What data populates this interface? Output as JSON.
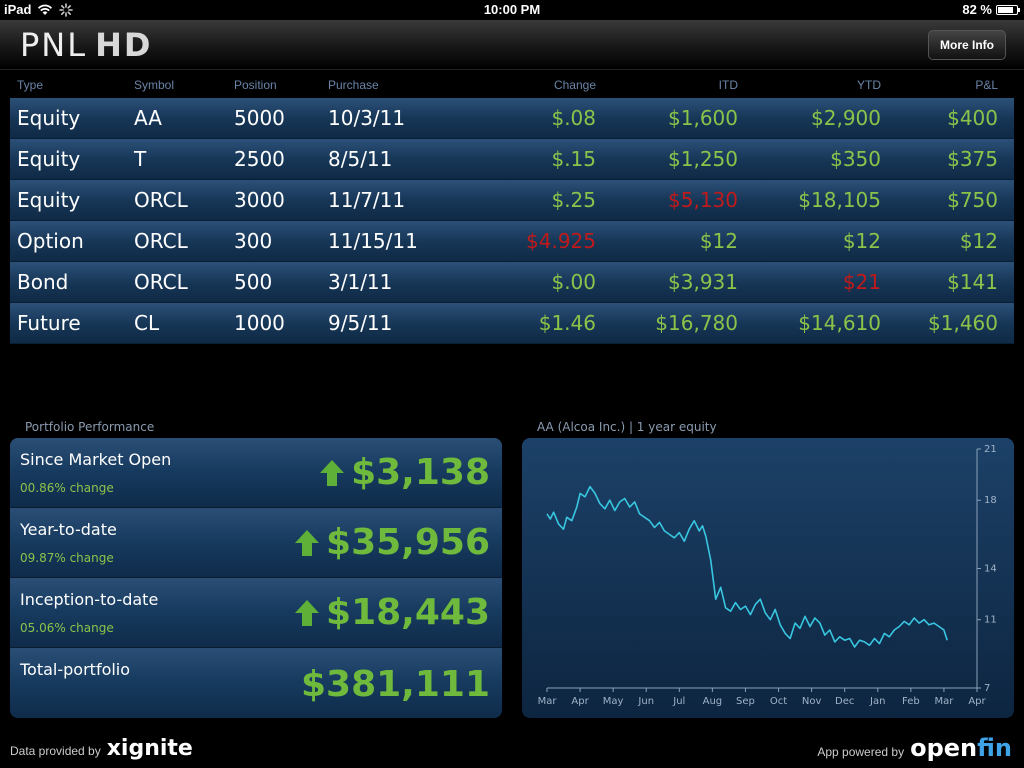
{
  "status_bar": {
    "device": "iPad",
    "time": "10:00 PM",
    "battery": "82 %",
    "battery_level": 0.82
  },
  "header": {
    "logo_pnl": "PNL",
    "logo_hd": "HD",
    "more_info_label": "More Info"
  },
  "table": {
    "columns": [
      "Type",
      "Symbol",
      "Position",
      "Purchase",
      "Change",
      "ITD",
      "YTD",
      "P&L"
    ],
    "rows": [
      {
        "type": "Equity",
        "symbol": "AA",
        "position": "5000",
        "purchase": "10/3/11",
        "change": "$.08",
        "change_status": "pos",
        "itd": "$1,600",
        "itd_status": "pos",
        "ytd": "$2,900",
        "ytd_status": "pos",
        "pnl": "$400",
        "pnl_status": "pos"
      },
      {
        "type": "Equity",
        "symbol": "T",
        "position": "2500",
        "purchase": "8/5/11",
        "change": "$.15",
        "change_status": "pos",
        "itd": "$1,250",
        "itd_status": "pos",
        "ytd": "$350",
        "ytd_status": "pos",
        "pnl": "$375",
        "pnl_status": "pos"
      },
      {
        "type": "Equity",
        "symbol": "ORCL",
        "position": "3000",
        "purchase": "11/7/11",
        "change": "$.25",
        "change_status": "pos",
        "itd": "$5,130",
        "itd_status": "neg",
        "ytd": "$18,105",
        "ytd_status": "pos",
        "pnl": "$750",
        "pnl_status": "pos"
      },
      {
        "type": "Option",
        "symbol": "ORCL",
        "position": "300",
        "purchase": "11/15/11",
        "change": "$4.925",
        "change_status": "neg",
        "itd": "$12",
        "itd_status": "pos",
        "ytd": "$12",
        "ytd_status": "pos",
        "pnl": "$12",
        "pnl_status": "pos"
      },
      {
        "type": "Bond",
        "symbol": "ORCL",
        "position": "500",
        "purchase": "3/1/11",
        "change": "$.00",
        "change_status": "pos",
        "itd": "$3,931",
        "itd_status": "pos",
        "ytd": "$21",
        "ytd_status": "neg",
        "pnl": "$141",
        "pnl_status": "pos"
      },
      {
        "type": "Future",
        "symbol": "CL",
        "position": "1000",
        "purchase": "9/5/11",
        "change": "$1.46",
        "change_status": "pos",
        "itd": "$16,780",
        "itd_status": "pos",
        "ytd": "$14,610",
        "ytd_status": "pos",
        "pnl": "$1,460",
        "pnl_status": "pos"
      }
    ]
  },
  "performance": {
    "title": "Portfolio Performance",
    "rows": [
      {
        "label": "Since Market Open",
        "sub": "00.86% change",
        "value": "$3,138",
        "arrow": true
      },
      {
        "label": "Year-to-date",
        "sub": "09.87% change",
        "value": "$35,956",
        "arrow": true
      },
      {
        "label": "Inception-to-date",
        "sub": "05.06% change",
        "value": "$18,443",
        "arrow": true
      },
      {
        "label": "Total-portfolio",
        "sub": "",
        "value": "$381,111",
        "arrow": false
      }
    ]
  },
  "chart_title": "AA (Alcoa Inc.) | 1 year equity",
  "chart_data": {
    "type": "line",
    "title": "AA (Alcoa Inc.) | 1 year equity",
    "x_ticks": [
      "Mar",
      "Apr",
      "May",
      "Jun",
      "Jul",
      "Aug",
      "Sep",
      "Oct",
      "Nov",
      "Dec",
      "Jan",
      "Feb",
      "Mar",
      "Apr"
    ],
    "y_ticks": [
      7,
      11,
      14,
      18,
      21
    ],
    "ylim": [
      7,
      21
    ],
    "series": [
      {
        "color": "#38c6e0",
        "x": [
          0,
          0.1,
          0.2,
          0.35,
          0.5,
          0.6,
          0.75,
          0.9,
          1.0,
          1.15,
          1.3,
          1.45,
          1.6,
          1.75,
          1.9,
          2.05,
          2.2,
          2.35,
          2.5,
          2.65,
          2.8,
          2.95,
          3.1,
          3.25,
          3.4,
          3.55,
          3.7,
          3.85,
          4.0,
          4.15,
          4.3,
          4.45,
          4.6,
          4.7,
          4.8,
          4.95,
          5.1,
          5.25,
          5.4,
          5.55,
          5.7,
          5.85,
          6.0,
          6.15,
          6.3,
          6.45,
          6.6,
          6.75,
          6.9,
          7.05,
          7.2,
          7.35,
          7.5,
          7.65,
          7.8,
          7.95,
          8.1,
          8.25,
          8.4,
          8.55,
          8.7,
          8.85,
          9.0,
          9.15,
          9.3,
          9.45,
          9.6,
          9.75,
          9.9,
          10.05,
          10.2,
          10.35,
          10.5,
          10.65,
          10.8,
          10.95,
          11.1,
          11.25,
          11.4,
          11.55,
          11.7,
          11.85,
          12.0,
          12.1
        ],
        "y": [
          17.2,
          16.9,
          17.3,
          16.6,
          16.3,
          17.0,
          16.8,
          17.6,
          18.4,
          18.2,
          18.8,
          18.4,
          17.8,
          17.5,
          18.0,
          17.4,
          17.9,
          18.1,
          17.6,
          17.9,
          17.2,
          17.0,
          16.8,
          16.4,
          16.7,
          16.2,
          16.0,
          15.8,
          16.1,
          15.6,
          16.3,
          16.8,
          16.2,
          16.5,
          15.9,
          14.5,
          12.2,
          12.9,
          11.7,
          11.5,
          12.0,
          11.6,
          11.8,
          11.3,
          11.9,
          12.2,
          11.4,
          11.0,
          11.6,
          10.7,
          10.2,
          9.9,
          10.8,
          10.5,
          11.2,
          10.6,
          11.1,
          10.8,
          10.1,
          10.4,
          9.7,
          10.0,
          9.8,
          9.9,
          9.4,
          9.8,
          9.7,
          9.5,
          9.9,
          9.6,
          10.2,
          10.0,
          10.4,
          10.6,
          10.9,
          10.7,
          11.1,
          10.8,
          11.0,
          10.7,
          10.8,
          10.6,
          10.4,
          9.8
        ]
      }
    ]
  },
  "footer": {
    "left_text": "Data provided by",
    "left_brand": "xignite",
    "right_text": "App powered by",
    "right_brand_a": "open",
    "right_brand_b": "fin"
  }
}
